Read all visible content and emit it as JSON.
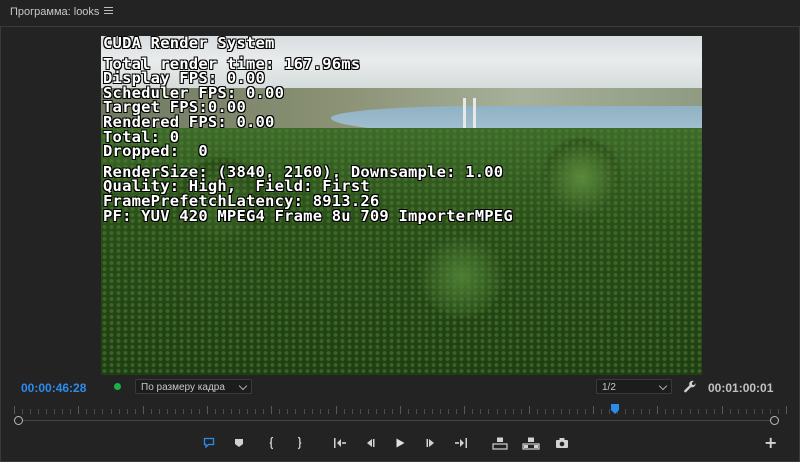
{
  "panel": {
    "title": "Программа: looks",
    "menu_icon": "hamburger-menu-icon"
  },
  "overlay": {
    "lines": [
      "CUDA Render System",
      "",
      "Total render time: 167.96ms",
      "Display FPS: 0.00",
      "Scheduler FPS: 0.00",
      "Target FPS:0.00",
      "Rendered FPS: 0.00",
      "Total: 0",
      "Dropped:  0",
      "",
      "RenderSize: (3840, 2160), Downsample: 1.00",
      "Quality: High,  Field: First",
      "FramePrefetchLatency: 8913.26",
      "PF: YUV 420 MPEG4 Frame 8u 709 ImporterMPEG"
    ]
  },
  "controls": {
    "current_timecode": "00:00:46:28",
    "fit_select": "По размеру кадра",
    "resolution_select": "1/2",
    "duration_timecode": "00:01:00:01",
    "settings_icon": "wrench-icon"
  },
  "colors": {
    "accent": "#2d8ceb",
    "status_green": "#19b24a",
    "background": "#232323"
  },
  "transport": {
    "buttons": [
      "add-marker-icon",
      "mark-in-icon",
      "mark-in-bracket-icon",
      "mark-out-bracket-icon",
      "go-to-in-icon",
      "step-back-icon",
      "play-icon",
      "step-forward-icon",
      "go-to-out-icon",
      "lift-icon",
      "extract-icon",
      "export-frame-icon",
      "button-editor-plus-icon"
    ]
  }
}
